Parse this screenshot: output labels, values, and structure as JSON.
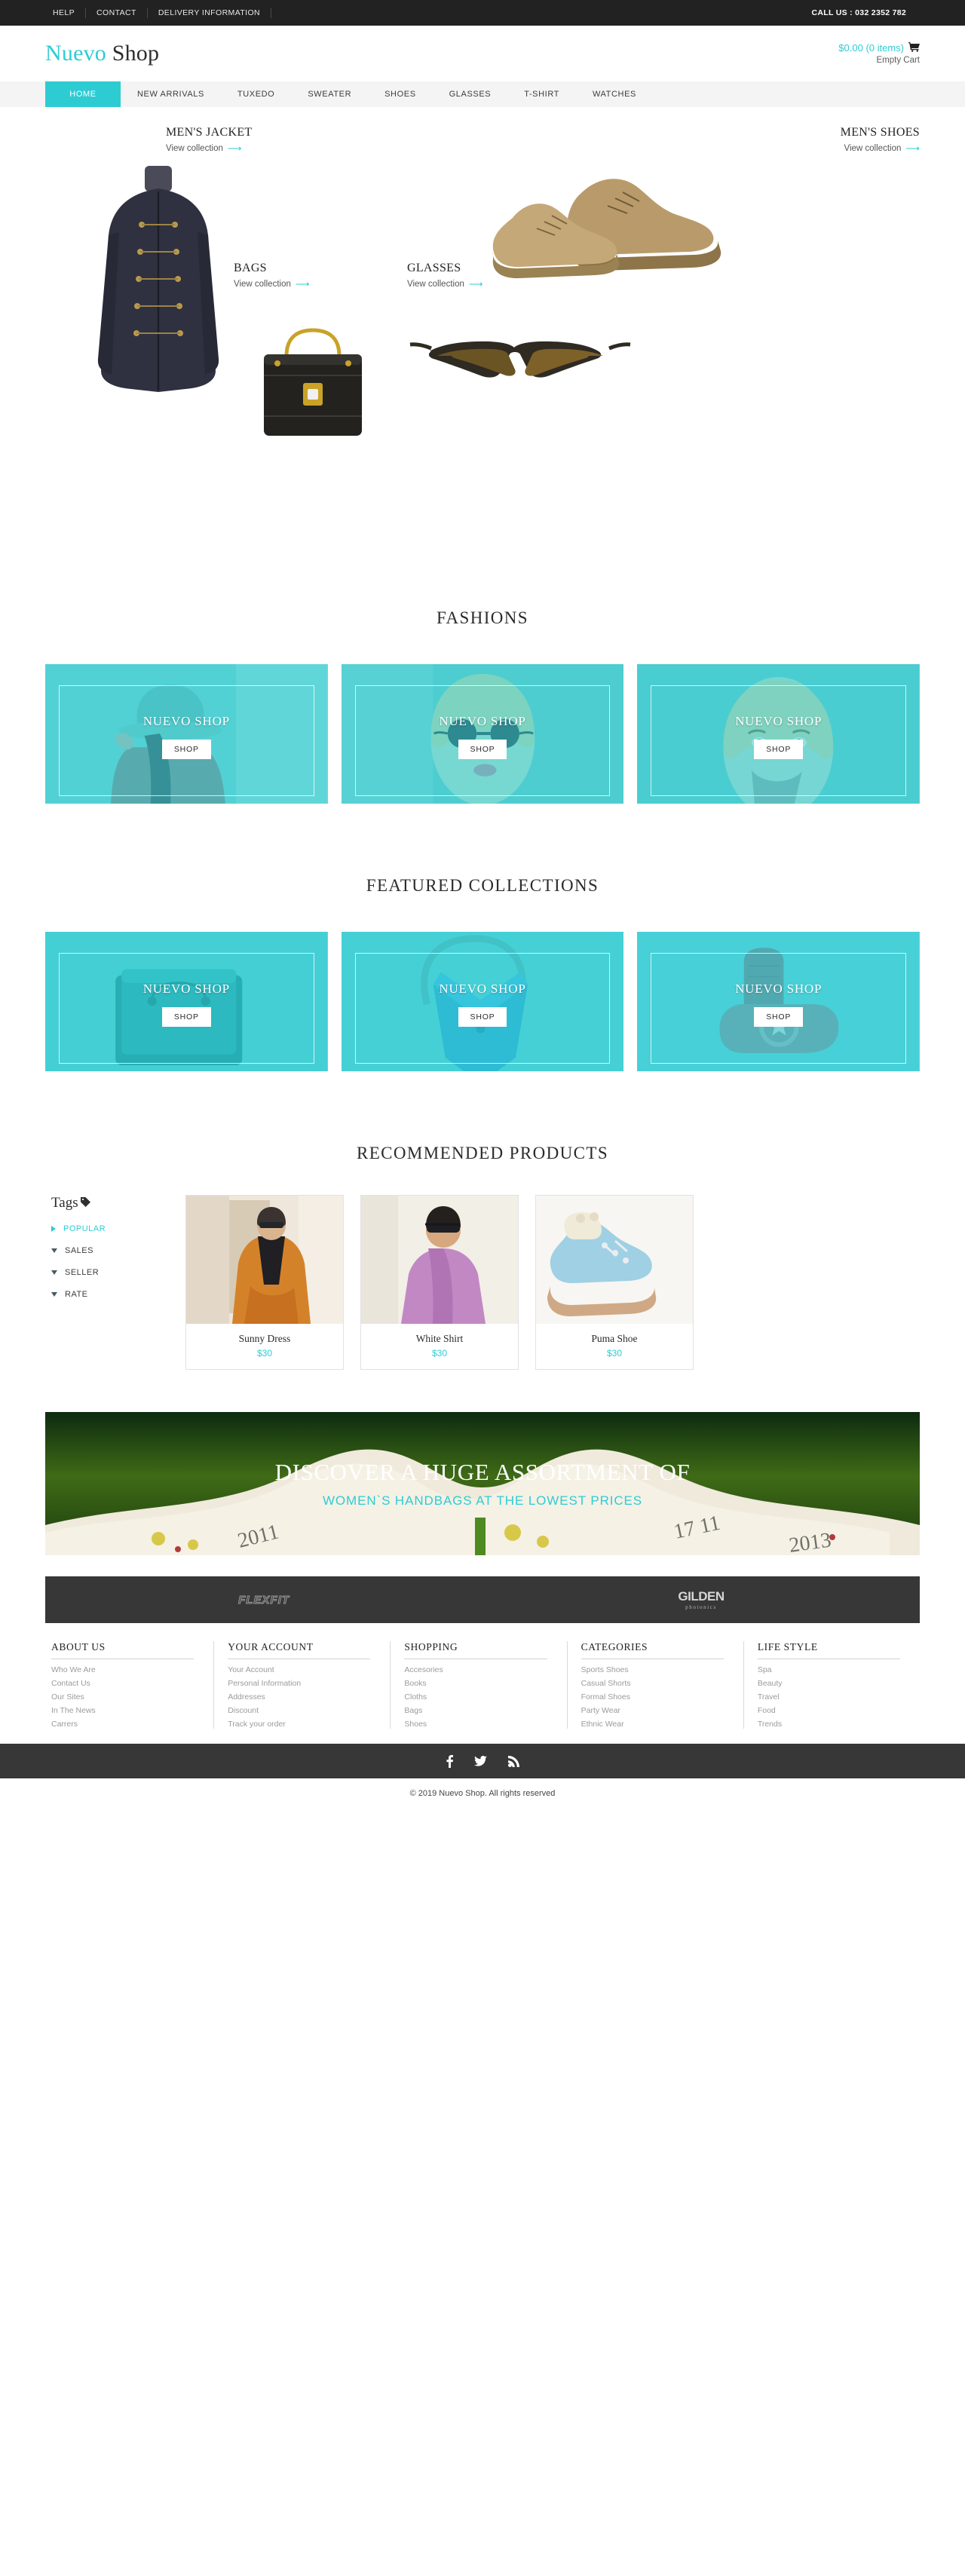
{
  "topbar": {
    "links": [
      "HELP",
      "CONTACT",
      "DELIVERY INFORMATION"
    ],
    "phone": "CALL US : 032 2352 782"
  },
  "header": {
    "logo_first": "Nuevo",
    "logo_second": "Shop",
    "cart_amount": "$0.00 (0 items)",
    "cart_icon": "cart-icon",
    "cart_status": "Empty Cart"
  },
  "nav": {
    "items": [
      {
        "label": "HOME",
        "active": true
      },
      {
        "label": "NEW ARRIVALS",
        "active": false
      },
      {
        "label": "TUXEDO",
        "active": false
      },
      {
        "label": "SWEATER",
        "active": false
      },
      {
        "label": "SHOES",
        "active": false
      },
      {
        "label": "GLASSES",
        "active": false
      },
      {
        "label": "T-SHIRT",
        "active": false
      },
      {
        "label": "WATCHES",
        "active": false
      }
    ]
  },
  "hero": {
    "categories": [
      {
        "title": "MEN'S JACKET",
        "link": "View collection"
      },
      {
        "title": "MEN'S SHOES",
        "link": "View collection"
      },
      {
        "title": "BAGS",
        "link": "View collection"
      },
      {
        "title": "GLASSES",
        "link": "View collection"
      }
    ]
  },
  "fashions": {
    "heading": "FASHIONS",
    "cards": [
      {
        "title": "NUEVO SHOP",
        "button": "SHOP"
      },
      {
        "title": "NUEVO SHOP",
        "button": "SHOP"
      },
      {
        "title": "NUEVO SHOP",
        "button": "SHOP"
      }
    ]
  },
  "featured": {
    "heading": "FEATURED COLLECTIONS",
    "cards": [
      {
        "title": "NUEVO SHOP",
        "button": "SHOP"
      },
      {
        "title": "NUEVO SHOP",
        "button": "SHOP"
      },
      {
        "title": "NUEVO SHOP",
        "button": "SHOP"
      }
    ]
  },
  "recommended": {
    "heading": "RECOMMENDED PRODUCTS",
    "tags_title": "Tags",
    "tags": [
      {
        "label": "POPULAR",
        "active": true
      },
      {
        "label": "SALES",
        "active": false
      },
      {
        "label": "SELLER",
        "active": false
      },
      {
        "label": "RATE",
        "active": false
      }
    ],
    "products": [
      {
        "name": "Sunny Dress",
        "price": "$30"
      },
      {
        "name": "White Shirt",
        "price": "$30"
      },
      {
        "name": "Puma Shoe",
        "price": "$30"
      }
    ]
  },
  "banner": {
    "line1": "DISCOVER A HUGE ASSORTMENT OF",
    "line2": "WOMEN`S HANDBAGS AT THE LOWEST PRICES"
  },
  "brands": [
    {
      "name": "FLEXFIT"
    },
    {
      "name": "GILDEN",
      "sub": "photonics"
    }
  ],
  "footer": {
    "columns": [
      {
        "title": "ABOUT US",
        "links": [
          "Who We Are",
          "Contact Us",
          "Our Sites",
          "In The News",
          "Carrers"
        ]
      },
      {
        "title": "YOUR ACCOUNT",
        "links": [
          "Your Account",
          "Personal Information",
          "Addresses",
          "Discount",
          "Track your order"
        ]
      },
      {
        "title": "SHOPPING",
        "links": [
          "Accesories",
          "Books",
          "Cloths",
          "Bags",
          "Shoes"
        ]
      },
      {
        "title": "CATEGORIES",
        "links": [
          "Sports Shoes",
          "Casual Shorts",
          "Formal Shoes",
          "Party Wear",
          "Ethnic Wear"
        ]
      },
      {
        "title": "LIFE STYLE",
        "links": [
          "Spa",
          "Beauty",
          "Travel",
          "Food",
          "Trends"
        ]
      }
    ],
    "social": [
      {
        "icon": "facebook-icon",
        "glyph": "f"
      },
      {
        "icon": "twitter-icon",
        "glyph": "ᴠ"
      },
      {
        "icon": "rss-icon",
        "glyph": "◔"
      }
    ],
    "copyright": "© 2019 Nuevo Shop. All rights reserved"
  },
  "colors": {
    "accent": "#2dccd3",
    "dark": "#222222",
    "footer_dark": "#373737"
  }
}
